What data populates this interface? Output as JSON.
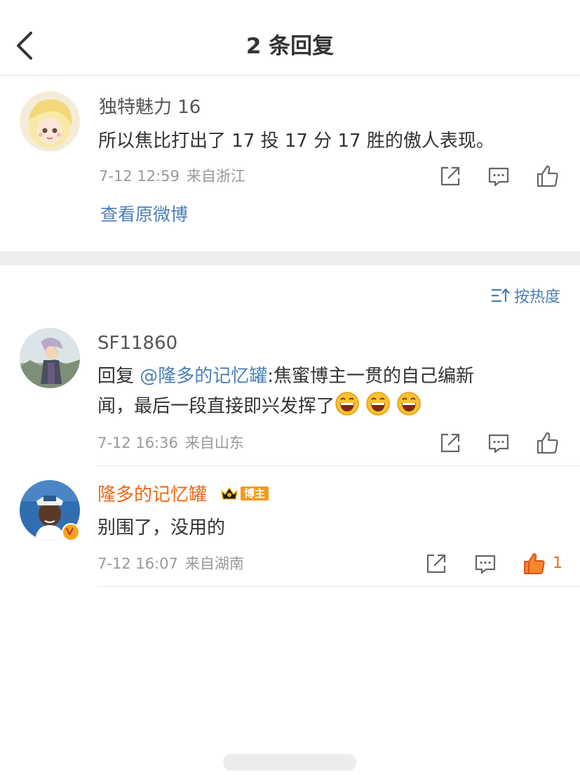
{
  "header": {
    "title": "2 条回复"
  },
  "original_comment": {
    "username": "独特魅力 16",
    "text": "所以焦比打出了 17 投 17 分 17 胜的傲人表现。",
    "time": "7-12 12:59",
    "location": "来自浙江",
    "view_original_label": "查看原微博"
  },
  "sort": {
    "label": "按热度"
  },
  "replies": [
    {
      "username": "SF11860",
      "reply_prefix": "回复 ",
      "mention": "@隆多的记忆罐",
      "text_line1": ":焦蜜博主一贯的自己编新",
      "text_line2": "闻，最后一段直接即兴发挥了",
      "emoji_count": 3,
      "time": "7-12 16:36",
      "location": "来自山东"
    },
    {
      "username": "隆多的记忆罐",
      "badge": "博主",
      "text": "别围了，没用的",
      "time": "7-12 16:07",
      "location": "来自湖南",
      "like_count": "1"
    }
  ],
  "colors": {
    "link": "#4a7fb8",
    "author_name": "#ee6a16",
    "liked": "#ee6a16",
    "meta": "#999999"
  },
  "icons": [
    "back-arrow-icon",
    "share-icon",
    "comment-icon",
    "like-icon",
    "sort-icon",
    "laugh-emoji-icon",
    "crown-icon",
    "verified-icon"
  ]
}
